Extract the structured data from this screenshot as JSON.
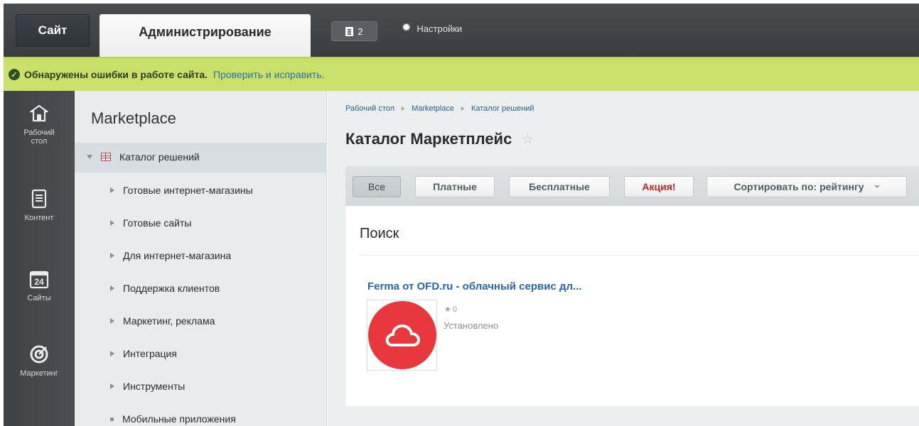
{
  "topbar": {
    "site_tab": "Сайт",
    "admin_tab": "Администрирование",
    "notifications_count": "2",
    "settings_label": "Настройки"
  },
  "alert": {
    "message": "Обнаружены ошибки в работе сайта.",
    "link": "Проверить и исправить."
  },
  "leftnav": {
    "items": [
      {
        "label_line1": "Рабочий",
        "label_line2": "стол",
        "icon": "home-icon"
      },
      {
        "label": "Контент",
        "icon": "document-icon"
      },
      {
        "label": "Сайты",
        "icon": "calendar-icon",
        "badge": "24"
      },
      {
        "label": "Маркетинг",
        "icon": "target-icon"
      }
    ]
  },
  "menu": {
    "title": "Marketplace",
    "selected": "Каталог решений",
    "items": [
      "Готовые интернет-магазины",
      "Готовые сайты",
      "Для интернет-магазина",
      "Поддержка клиентов",
      "Маркетинг, реклама",
      "Интеграция",
      "Инструменты",
      "Мобильные приложения"
    ]
  },
  "breadcrumb": [
    "Рабочий стол",
    "Marketplace",
    "Каталог решений"
  ],
  "page_title": "Каталог Маркетплейс",
  "filters": {
    "all": "Все",
    "paid": "Платные",
    "free": "Бесплатные",
    "promo": "Акция!",
    "sort": "Сортировать по: рейтингу"
  },
  "search": {
    "title": "Поиск"
  },
  "result": {
    "title": "Ferma от OFD.ru - облачный сервис дл...",
    "rating": "0",
    "status": "Установлено"
  },
  "colors": {
    "alert_bg": "#c9e06a",
    "link": "#2665b1",
    "promo": "#c2261d",
    "app_icon_bg": "#e8383d"
  }
}
